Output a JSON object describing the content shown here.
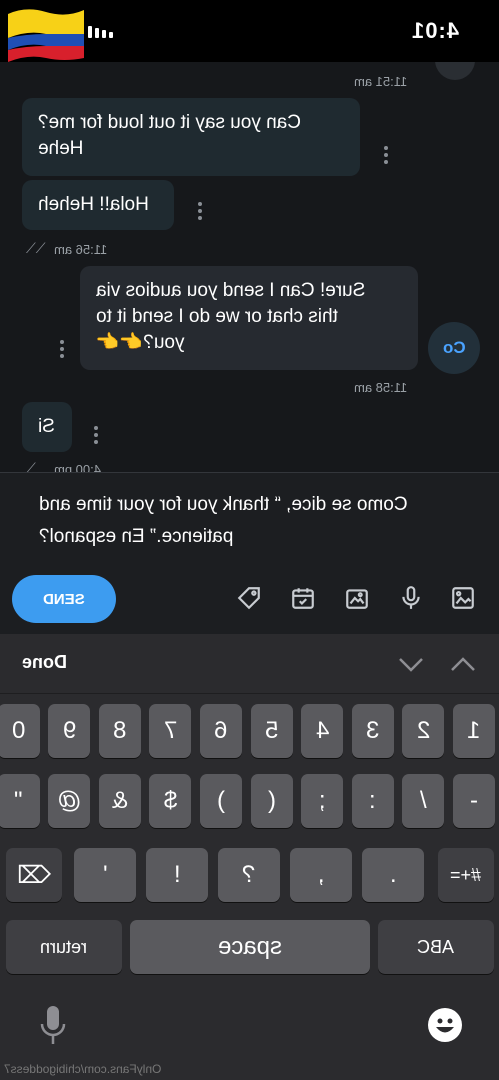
{
  "status": {
    "time": "4:01"
  },
  "chat": {
    "messages": [
      {
        "text_line1": "Can you say it out loud for me?",
        "text_line2": "Hehe"
      },
      {
        "text": "Hola!! Heheh"
      },
      {
        "text_line1": "Sure! Can I send you audios via",
        "text_line2": "this chat or we do I send it to",
        "text_line3": "you?👉👉"
      },
      {
        "text": "Si"
      }
    ],
    "timestamps": [
      "11:51 am",
      "11:56 am",
      "11:58 am",
      "4:00 pm"
    ],
    "avatar_initials": "Co"
  },
  "composer": {
    "line1": "Como se dice, “ thank you for your time and",
    "line2": "patience.” En espanol?",
    "send_label": "SEND",
    "tools": [
      "gallery-icon",
      "mic-icon",
      "camera-icon",
      "schedule-icon",
      "price-tag-icon"
    ]
  },
  "keyboard": {
    "done_label": "Done",
    "row1": [
      "1",
      "2",
      "3",
      "4",
      "5",
      "6",
      "7",
      "8",
      "9",
      "0"
    ],
    "row2": [
      "-",
      "/",
      ":",
      ";",
      "(",
      ")",
      "$",
      "&",
      "@",
      "\""
    ],
    "row3": [
      ".",
      ",",
      "?",
      "!",
      "'"
    ],
    "shift_label": "#+=",
    "abc_label": "ABC",
    "space_label": "space",
    "return_label": "return"
  },
  "watermark": "OnlyFans.com/chibigoddess7",
  "colors": {
    "accent": "#3d9cf0",
    "chat_bg": "#16181b",
    "keyboard_bg": "#2b2b2e"
  }
}
